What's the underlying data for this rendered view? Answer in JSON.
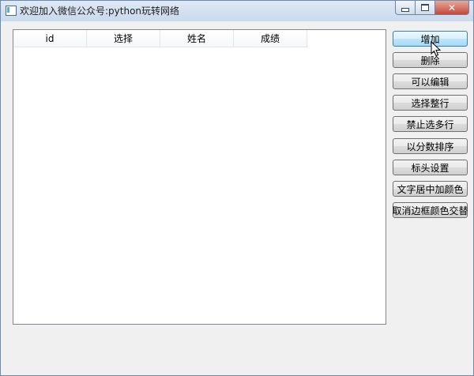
{
  "window": {
    "title": "欢迎加入微信公众号:python玩转网络",
    "close_glyph": "✕"
  },
  "table": {
    "headers": [
      "id",
      "选择",
      "姓名",
      "成绩"
    ],
    "rows": []
  },
  "buttons": [
    {
      "label": "增加",
      "state": "hover"
    },
    {
      "label": "删除"
    },
    {
      "label": "可以编辑"
    },
    {
      "label": "选择整行"
    },
    {
      "label": "禁止选多行"
    },
    {
      "label": "以分数排序"
    },
    {
      "label": "标头设置"
    },
    {
      "label": "文字居中加颜色"
    },
    {
      "label": "取消边框颜色交替"
    }
  ]
}
